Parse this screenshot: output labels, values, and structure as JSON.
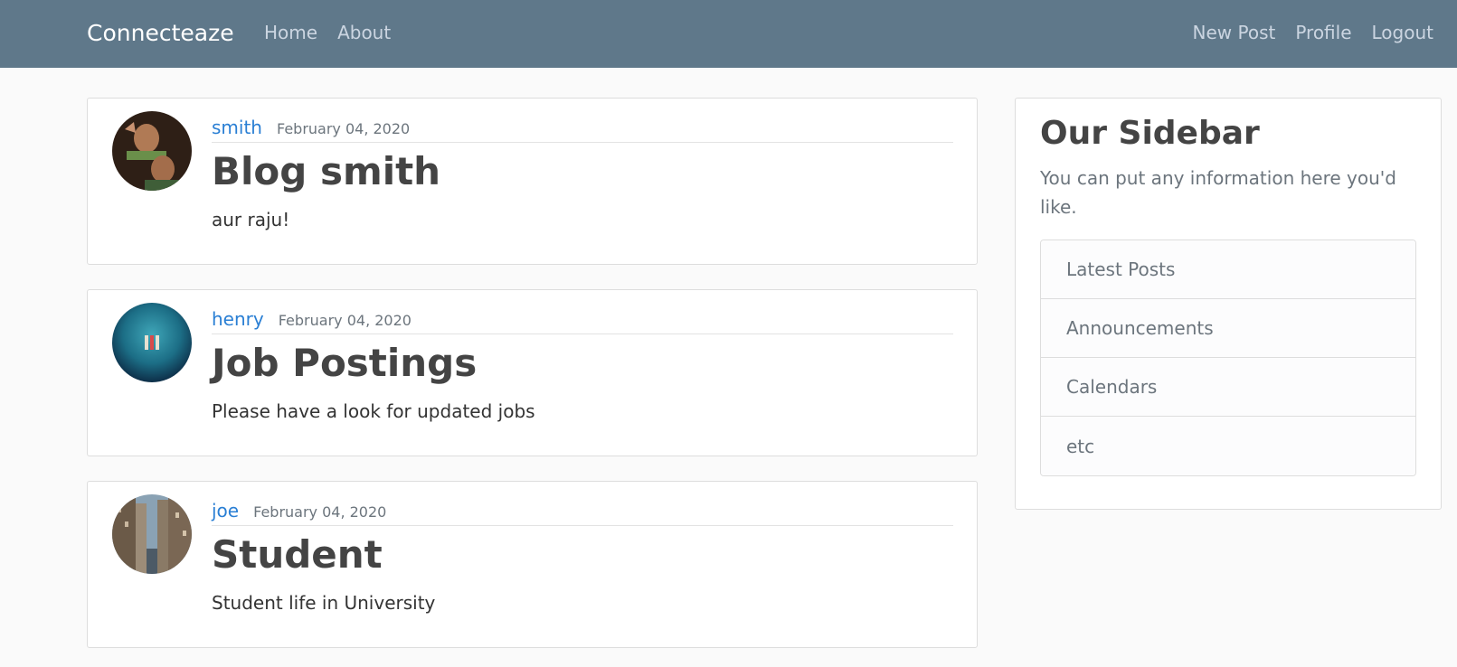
{
  "nav": {
    "brand": "Connecteaze",
    "left_links": [
      "Home",
      "About"
    ],
    "right_links": [
      "New Post",
      "Profile",
      "Logout"
    ]
  },
  "posts": [
    {
      "author": "smith",
      "date": "February 04, 2020",
      "title": "Blog smith",
      "content": "aur raju!"
    },
    {
      "author": "henry",
      "date": "February 04, 2020",
      "title": "Job Postings",
      "content": "Please have a look for updated jobs"
    },
    {
      "author": "joe",
      "date": "February 04, 2020",
      "title": "Student",
      "content": "Student life in University"
    }
  ],
  "sidebar": {
    "title": "Our Sidebar",
    "text": "You can put any information here you'd like.",
    "items": [
      "Latest Posts",
      "Announcements",
      "Calendars",
      "etc"
    ]
  },
  "colors": {
    "navbar": "#5f788a",
    "link": "#2a7fd4",
    "background": "#fafafa"
  }
}
